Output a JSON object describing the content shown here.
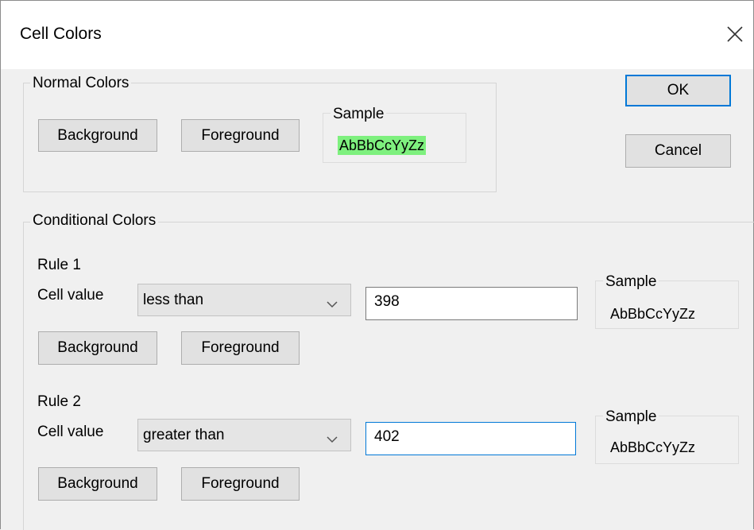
{
  "window": {
    "title": "Cell Colors"
  },
  "actions": {
    "ok_label": "OK",
    "cancel_label": "Cancel"
  },
  "normal": {
    "legend": "Normal Colors",
    "background_label": "Background",
    "foreground_label": "Foreground",
    "sample_legend": "Sample",
    "sample_text": "AbBbCcYyZz",
    "sample_bg_color": "#7ef07e"
  },
  "conditional": {
    "legend": "Conditional Colors",
    "rules": [
      {
        "title": "Rule 1",
        "cell_value_label": "Cell value",
        "operator": "less than",
        "value": "398",
        "background_label": "Background",
        "foreground_label": "Foreground",
        "sample_legend": "Sample",
        "sample_text": "AbBbCcYyZz"
      },
      {
        "title": "Rule 2",
        "cell_value_label": "Cell value",
        "operator": "greater than",
        "value": "402",
        "background_label": "Background",
        "foreground_label": "Foreground",
        "sample_legend": "Sample",
        "sample_text": "AbBbCcYyZz"
      }
    ]
  },
  "colors": {
    "focus_accent": "#0078d7",
    "button_face": "#e1e1e1"
  }
}
